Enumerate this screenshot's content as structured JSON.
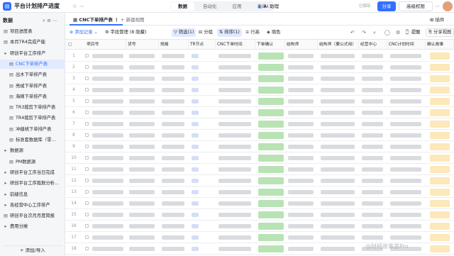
{
  "app": {
    "title": "平台计划排产进度",
    "saved": "已保存"
  },
  "top_tabs": [
    "数据",
    "自动化",
    "应用",
    "表单"
  ],
  "ai_label": "AI 助理",
  "share_label": "分享",
  "advanced_label": "高级权限",
  "sidebar": {
    "header": "数据",
    "items": [
      {
        "label": "项目进度表",
        "icon": "table-icon",
        "indent": 0
      },
      {
        "label": "本月TR4完成产能",
        "icon": "table-icon",
        "indent": 0
      },
      {
        "label": "研创平台工序排产",
        "icon": "folder-icon",
        "indent": 0
      },
      {
        "label": "CNC下单排产表",
        "icon": "table-icon",
        "indent": 1,
        "active": true
      },
      {
        "label": "出木下单排产表",
        "icon": "table-icon",
        "indent": 1
      },
      {
        "label": "亮绒下单排产表",
        "icon": "table-icon",
        "indent": 1
      },
      {
        "label": "海绵下单排产表",
        "icon": "table-icon",
        "indent": 1
      },
      {
        "label": "TR3裁剪下单排产表",
        "icon": "table-icon",
        "indent": 1
      },
      {
        "label": "TR4裁剪下单排产表",
        "icon": "table-icon",
        "indent": 1
      },
      {
        "label": "冲缝绣下单排产表",
        "icon": "table-icon",
        "indent": 1
      },
      {
        "label": "标准套数据库（零...",
        "icon": "table-icon",
        "indent": 1
      },
      {
        "label": "数据源",
        "icon": "folder-icon",
        "indent": 0
      },
      {
        "label": "PM数据源",
        "icon": "table-icon",
        "indent": 1
      },
      {
        "label": "研创平台工序当日完成",
        "icon": "folder-icon",
        "indent": 0
      },
      {
        "label": "研创平台工序裁数分析...",
        "icon": "folder-icon",
        "indent": 0
      },
      {
        "label": "前缝信息",
        "icon": "folder-icon",
        "indent": 0
      },
      {
        "label": "各经营中心工序排产",
        "icon": "folder-icon",
        "indent": 0
      },
      {
        "label": "研创平台次月月度简报",
        "icon": "table-icon",
        "indent": 0
      },
      {
        "label": "费用分摊",
        "icon": "folder-icon",
        "indent": 0
      }
    ],
    "add_label": "+ 添加/导入"
  },
  "view_tab": "CNC下单排产表",
  "new_view": "+ 新建视图",
  "plugin_label": "插件",
  "toolbar": {
    "add_record": "添加记录",
    "field_manage": "字段管理 (8 隐藏)",
    "filter": "筛选(1)",
    "group": "分组",
    "sort": "排序(1)",
    "row_height": "行高",
    "fill": "填色",
    "remind": "提醒",
    "share_view": "分享视图"
  },
  "columns": [
    "项目号",
    "货号",
    "规格",
    "TR节点",
    "CNC下单时间",
    "下单确认",
    "结构师",
    "结构师（要公式用）",
    "经营中心",
    "CNC计划时间",
    "确认故事"
  ],
  "row_numbers": [
    "1",
    "2",
    "3",
    "4",
    "5",
    "6",
    "7",
    "8",
    "9",
    "10",
    "11",
    "12",
    "13",
    "14",
    "15",
    "16",
    "17",
    "18",
    "19"
  ],
  "watermark": "@财经故事荟Pro"
}
